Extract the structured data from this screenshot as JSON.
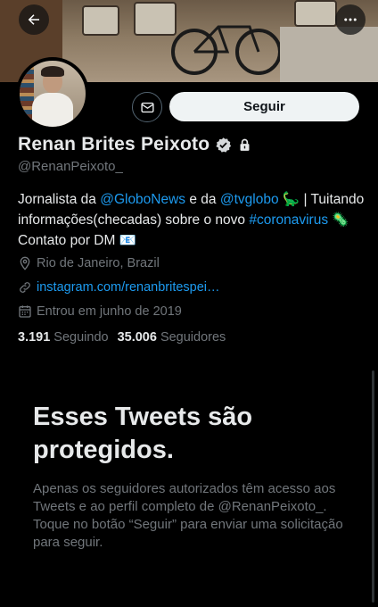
{
  "profile": {
    "display_name": "Renan Brites Peixoto",
    "handle": "@RenanPeixoto_",
    "follow_label": "Seguir",
    "bio": {
      "p1": "Jornalista da ",
      "mention1": "@GloboNews",
      "p2": " e da ",
      "mention2": "@tvglobo",
      "p3": " 🦕 | Tuitando informações(checadas) sobre o novo ",
      "hashtag": "#coronavirus",
      "p4": " 🦠 Contato por DM 📧"
    },
    "location": "Rio de Janeiro, Brazil",
    "website": "instagram.com/renanbritespei…",
    "joined": "Entrou em junho de 2019",
    "following_count": "3.191",
    "following_label": "Seguindo",
    "followers_count": "35.006",
    "followers_label": "Seguidores"
  },
  "protected": {
    "title": "Esses Tweets são protegidos.",
    "description": "Apenas os seguidores autorizados têm acesso aos Tweets e ao perfil completo de @RenanPeixoto_. Toque no botão “Seguir” para enviar uma solicitação para seguir."
  },
  "colors": {
    "background": "#000000",
    "text": "#e7e9ea",
    "secondary": "#71767b",
    "link": "#1d9bf0",
    "button_bg": "#eff3f4"
  },
  "icons": [
    "back-arrow-icon",
    "more-icon",
    "mail-icon",
    "verified-badge-icon",
    "lock-icon",
    "location-icon",
    "link-icon",
    "calendar-icon"
  ]
}
